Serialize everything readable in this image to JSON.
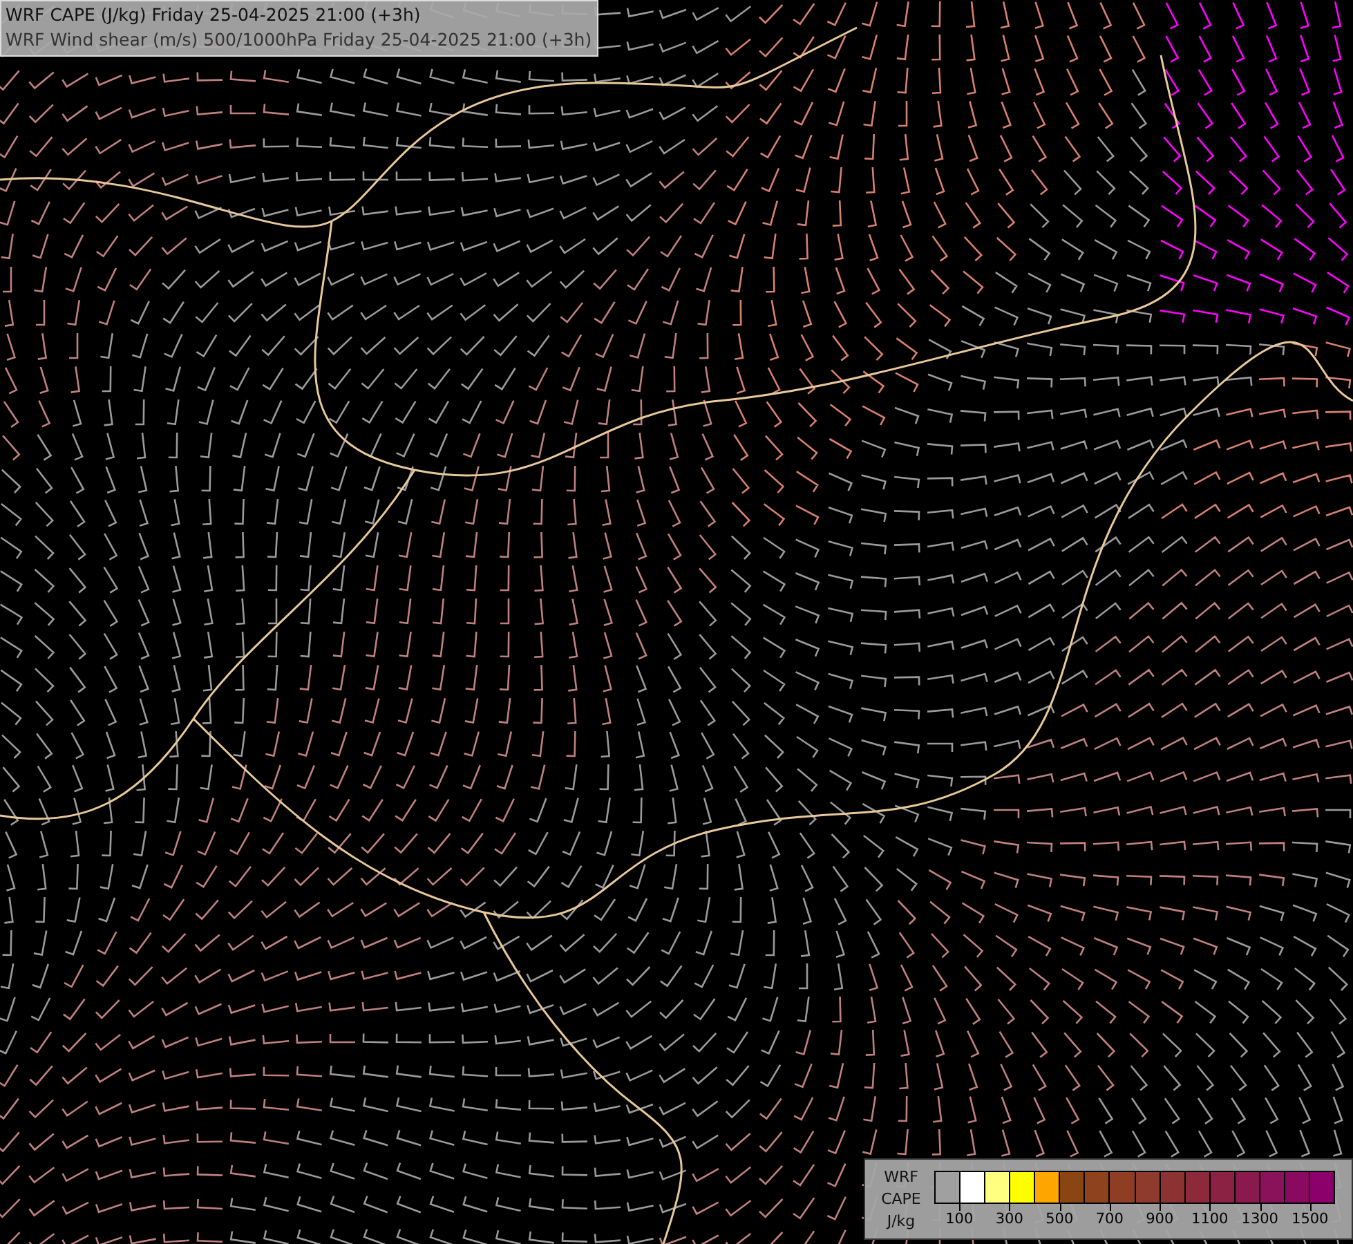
{
  "title_lines": [
    "WRF CAPE (J/kg) Friday 25-04-2025 21:00 (+3h)",
    "WRF Wind shear (m/s) 500/1000hPa Friday 25-04-2025 21:00 (+3h)"
  ],
  "legend": {
    "label_lines": [
      "WRF",
      "CAPE",
      "J/kg"
    ],
    "swatches": [
      {
        "color": "#a0a0a0"
      },
      {
        "color": "#ffffff",
        "label": "100"
      },
      {
        "color": "#ffff80"
      },
      {
        "color": "#ffff00",
        "label": "300"
      },
      {
        "color": "#ffa500"
      },
      {
        "color": "#8b4513",
        "label": "500"
      },
      {
        "color": "#8e421e"
      },
      {
        "color": "#8f3e24",
        "label": "700"
      },
      {
        "color": "#8e3a2c"
      },
      {
        "color": "#8d3232",
        "label": "900"
      },
      {
        "color": "#8c2a3c"
      },
      {
        "color": "#8b2244",
        "label": "1100"
      },
      {
        "color": "#8a1a4e"
      },
      {
        "color": "#8a125a",
        "label": "1300"
      },
      {
        "color": "#8a0a62"
      },
      {
        "color": "#8b006b",
        "label": "1500"
      }
    ]
  }
}
